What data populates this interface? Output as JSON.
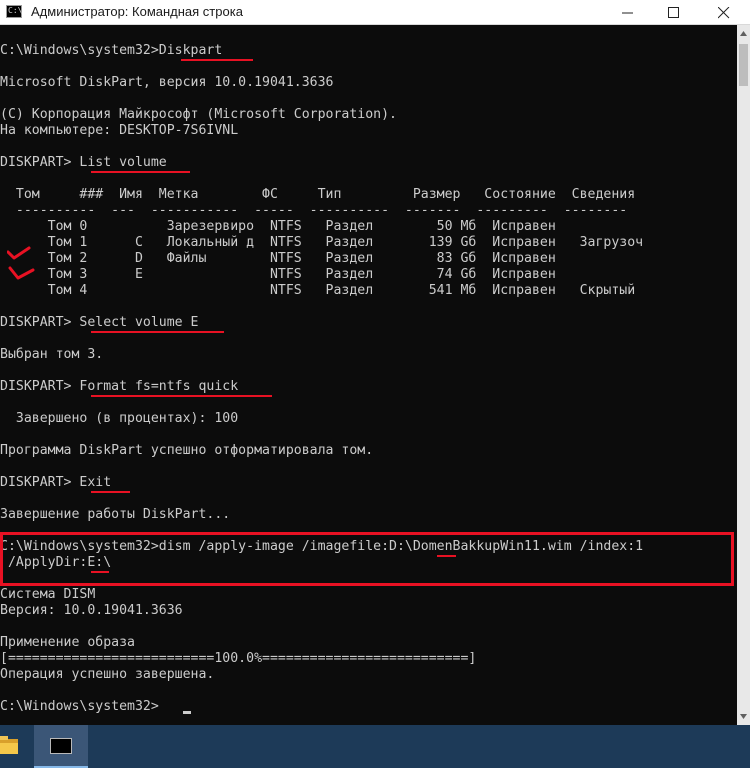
{
  "window": {
    "title": "Администратор: Командная строка",
    "icon_label": "C:\\",
    "controls": [
      "minimize-icon",
      "maximize-icon",
      "close-icon"
    ]
  },
  "console": {
    "foreground": "#cccccc",
    "background": "#0c0c0c",
    "lines": [
      "C:\\Windows\\system32>Diskpart",
      "",
      "Microsoft DiskPart, версия 10.0.19041.3636",
      "",
      "(C) Корпорация Майкрософт (Microsoft Corporation).",
      "На компьютере: DESKTOP-7S6IVNL",
      "",
      "DISKPART> List volume",
      "",
      "  Том     ###  Имя  Метка        ФС     Тип         Размер   Состояние  Сведения",
      "  ----------  ---  -----------  -----  ----------  -------  ---------  --------",
      "      Том 0          Зарезервиро  NTFS   Раздел        50 Мб  Исправен",
      "      Том 1      C   Локальный д  NTFS   Раздел       139 Gб  Исправен   Загрузоч",
      "      Том 2      D   Файлы        NTFS   Раздел        83 Gб  Исправен",
      "      Том 3      E                NTFS   Раздел        74 Gб  Исправен",
      "      Том 4                       NTFS   Раздел       541 Мб  Исправен   Скрытый",
      "",
      "DISKPART> Select volume E",
      "",
      "Выбран том 3.",
      "",
      "DISKPART> Format fs=ntfs quick",
      "",
      "  Завершено (в процентах): 100",
      "",
      "Программа DiskPart успешно отформатировала том.",
      "",
      "DISKPART> Exit",
      "",
      "Завершение работы DiskPart...",
      "",
      "C:\\Windows\\system32>dism /apply-image /imagefile:D:\\DomenBakkupWin11.wim /index:1",
      " /ApplyDir:E:\\",
      "",
      "Система DISM",
      "Версия: 10.0.19041.3636",
      "",
      "Применение образа",
      "[==========================100.0%==========================]",
      "Операция успешно завершена.",
      "",
      "C:\\Windows\\system32>"
    ]
  },
  "annotations": {
    "color": "#e81123"
  },
  "taskbar": {
    "background": "#1d3a58",
    "items": [
      "folder-icon",
      "command-prompt-icon"
    ]
  }
}
